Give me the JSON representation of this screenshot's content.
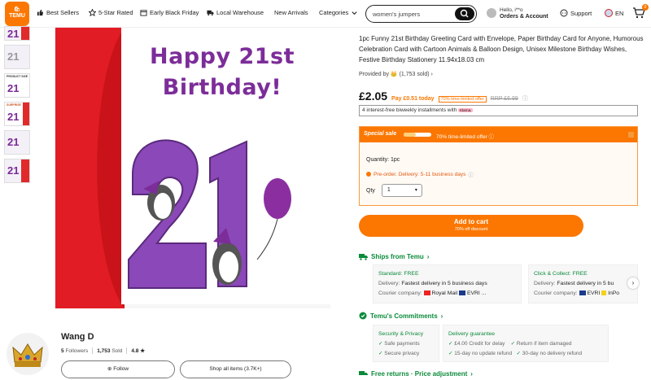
{
  "header": {
    "logo_top": "🛍",
    "logo_text": "TEMU",
    "nav": [
      "Best Sellers",
      "5-Star Rated",
      "Early Black Friday",
      "Local Warehouse",
      "New Arrivals",
      "Categories"
    ],
    "search_value": "women's jumpers",
    "account_line1": "Hello, i**o",
    "account_line2": "Orders & Account",
    "support": "Support",
    "lang": "EN",
    "cart_count": "0"
  },
  "card": {
    "line1": "Happy 21st",
    "line2": "Birthday!",
    "number": "21"
  },
  "product": {
    "title": "1pc Funny 21st Birthday Greeting Card with Envelope, Paper Birthday Card for Anyone, Humorous Celebration Card with Cartoon Animals & Balloon Design, Unisex Milestone Birthday Wishes, Festive Birthday Stationery 11.94x18.03 cm",
    "provided_by": "Provided by",
    "provided_count": "(1,753 sold)",
    "price": "£2.05",
    "pay_today": "Pay £0.51 today",
    "limited_tag": "70% time-limited offer",
    "rrp": "RRP £6.99",
    "installments": "4 interest-free biweekly installments with",
    "klarna": "Klarna.",
    "special_sale": "Special sale",
    "offer_text": "70% time-limited offer",
    "offer_progress": 0.45,
    "quantity_label": "Quantity: 1pc",
    "preorder": "Pre-order. Delivery: 5-11 business days",
    "qty_label": "Qty",
    "qty_value": "1",
    "add_to_cart": "Add to cart",
    "add_sub": "70% off discount"
  },
  "shipping": {
    "title": "Ships from Temu",
    "standard_title": "Standard: FREE",
    "standard_delivery_label": "Delivery:",
    "standard_delivery": "Fastest delivery in 5 business days",
    "standard_courier_label": "Courier company:",
    "standard_courier": "Royal Mail",
    "standard_courier2": "EVRI ...",
    "cc_title": "Click & Collect: FREE",
    "cc_delivery_label": "Delivery:",
    "cc_delivery": "Fastest delivery in 5 bu",
    "cc_courier_label": "Courier company:",
    "cc_courier": "EVRI",
    "cc_courier2": "InPo"
  },
  "commitments": {
    "title": "Temu's Commitments",
    "sec_title": "Security & Privacy",
    "sec_items": [
      "Safe payments",
      "Secure privacy"
    ],
    "del_title": "Delivery guarantee",
    "del_items": [
      "£4.00 Credit for delay",
      "15-day no update refund"
    ],
    "del_items2": [
      "Return if item damaged",
      "30-day no delivery refund"
    ]
  },
  "free_returns": "Free returns · Price adjustment",
  "seller": {
    "name": "Wang D",
    "followers_num": "5",
    "followers_label": "Followers",
    "sold_num": "1,753",
    "sold_label": "Sold",
    "rating": "4.8 ★",
    "follow": "Follow",
    "shop_all": "Shop all items (3.7K+)"
  },
  "colors": {
    "accent": "#fb7701",
    "green": "#0a8a3a",
    "purple": "#7c2d99"
  }
}
